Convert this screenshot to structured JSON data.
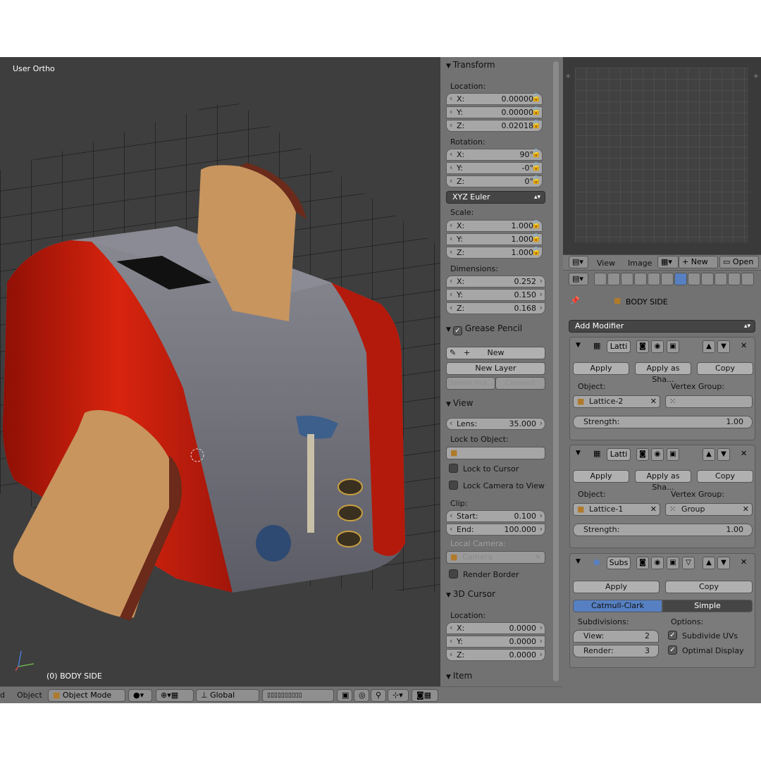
{
  "viewport": {
    "view_name": "User Ortho",
    "object_label": "(0) BODY SIDE",
    "axis_labels": {
      "x": "x",
      "y": "y",
      "z": "z"
    }
  },
  "npanel": {
    "transform": {
      "title": "Transform",
      "location_label": "Location:",
      "location": [
        {
          "k": "X:",
          "v": "0.00000"
        },
        {
          "k": "Y:",
          "v": "0.00000"
        },
        {
          "k": "Z:",
          "v": "0.02018"
        }
      ],
      "rotation_label": "Rotation:",
      "rotation": [
        {
          "k": "X:",
          "v": "90°"
        },
        {
          "k": "Y:",
          "v": "-0°"
        },
        {
          "k": "Z:",
          "v": "0°"
        }
      ],
      "rotation_mode": "XYZ Euler",
      "scale_label": "Scale:",
      "scale": [
        {
          "k": "X:",
          "v": "1.000"
        },
        {
          "k": "Y:",
          "v": "1.000"
        },
        {
          "k": "Z:",
          "v": "1.000"
        }
      ],
      "dimensions_label": "Dimensions:",
      "dimensions": [
        {
          "k": "X:",
          "v": "0.252"
        },
        {
          "k": "Y:",
          "v": "0.150"
        },
        {
          "k": "Z:",
          "v": "0.168"
        }
      ]
    },
    "grease": {
      "title": "Grease Pencil",
      "new": "New",
      "new_layer": "New Layer",
      "delete_frame": "Delete Fra...",
      "convert": "Convert"
    },
    "view": {
      "title": "View",
      "lens_k": "Lens:",
      "lens_v": "35.000",
      "lock_to_object": "Lock to Object:",
      "lock_to_cursor": "Lock to Cursor",
      "lock_camera": "Lock Camera to View",
      "clip": "Clip:",
      "clip_start_k": "Start:",
      "clip_start_v": "0.100",
      "clip_end_k": "End:",
      "clip_end_v": "100.000",
      "local_camera": "Local Camera:",
      "camera": "Camera",
      "render_border": "Render Border"
    },
    "cursor": {
      "title": "3D Cursor",
      "location_label": "Location:",
      "location": [
        {
          "k": "X:",
          "v": "0.0000"
        },
        {
          "k": "Y:",
          "v": "0.0000"
        },
        {
          "k": "Z:",
          "v": "0.0000"
        }
      ]
    },
    "item": {
      "title": "Item"
    }
  },
  "image_editor": {
    "view": "View",
    "image": "Image",
    "new": "New",
    "open": "Open"
  },
  "properties": {
    "object_name": "BODY SIDE",
    "add_modifier": "Add Modifier",
    "mod1": {
      "name": "Latti",
      "apply": "Apply",
      "apply_shape": "Apply as Sha...",
      "copy": "Copy",
      "object_label": "Object:",
      "object_value": "Lattice-2",
      "vgroup_label": "Vertex Group:",
      "vgroup_value": "",
      "strength_k": "Strength:",
      "strength_v": "1.00"
    },
    "mod2": {
      "name": "Latti",
      "apply": "Apply",
      "apply_shape": "Apply as Sha...",
      "copy": "Copy",
      "object_label": "Object:",
      "object_value": "Lattice-1",
      "vgroup_label": "Vertex Group:",
      "vgroup_value": "Group",
      "strength_k": "Strength:",
      "strength_v": "1.00"
    },
    "mod3": {
      "name": "Subs",
      "apply": "Apply",
      "copy": "Copy",
      "catmull": "Catmull-Clark",
      "simple": "Simple",
      "subdivisions": "Subdivisions:",
      "options": "Options:",
      "view_k": "View:",
      "view_v": "2",
      "render_k": "Render:",
      "render_v": "3",
      "subdivide_uvs": "Subdivide UVs",
      "optimal_display": "Optimal Display"
    }
  },
  "toolbar": {
    "d": "d",
    "object": "Object",
    "mode": "Object Mode",
    "orientation": "Global"
  },
  "colors": {
    "accent": "#5680c2",
    "toaster_red": "#c01a0a",
    "bread": "#c8955f",
    "crust": "#6b2a1a"
  }
}
